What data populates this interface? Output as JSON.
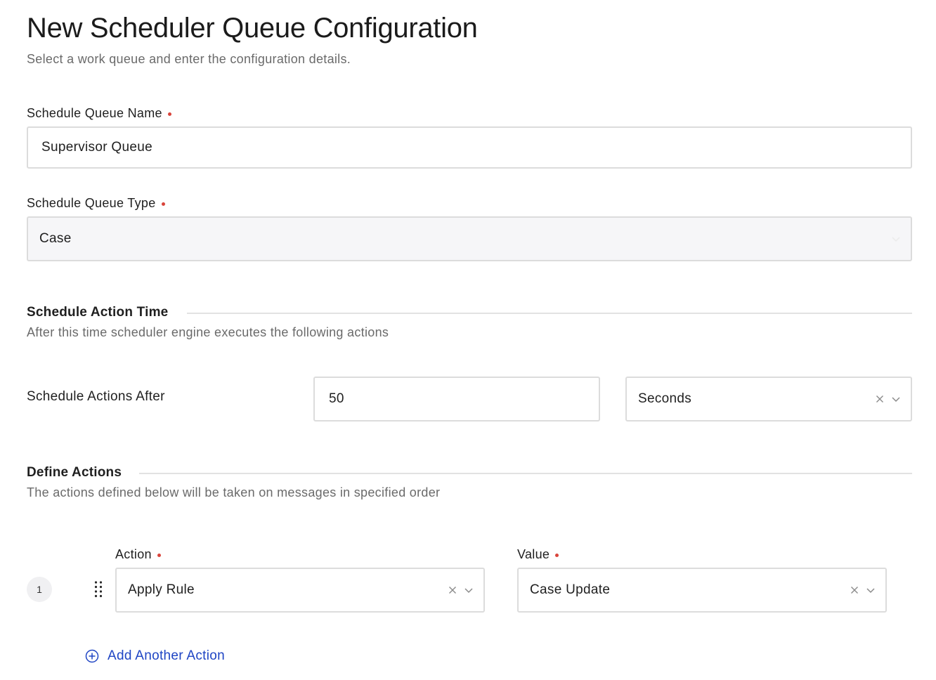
{
  "page": {
    "title": "New Scheduler Queue Configuration",
    "subtitle": "Select a work queue and enter the configuration details."
  },
  "queue_name": {
    "label": "Schedule Queue Name",
    "value": "Supervisor Queue",
    "required": true
  },
  "queue_type": {
    "label": "Schedule Queue Type",
    "value": "Case",
    "required": true
  },
  "action_time": {
    "title": "Schedule Action Time",
    "description": "After this time scheduler engine executes the following actions",
    "row_label": "Schedule Actions After",
    "amount": "50",
    "unit": "Seconds"
  },
  "define_actions": {
    "title": "Define Actions",
    "description": "The actions defined below will be taken on messages in specified order",
    "action_label": "Action",
    "value_label": "Value",
    "rows": [
      {
        "index": "1",
        "action": "Apply Rule",
        "value": "Case Update"
      }
    ],
    "add_label": "Add Another Action"
  },
  "colors": {
    "required_dot": "#d9443b",
    "link": "#1f45c4",
    "border": "#dcdcdc"
  },
  "icons": [
    "clear-icon",
    "chevron-down-icon",
    "drag-handle-icon",
    "add-circle-icon"
  ]
}
